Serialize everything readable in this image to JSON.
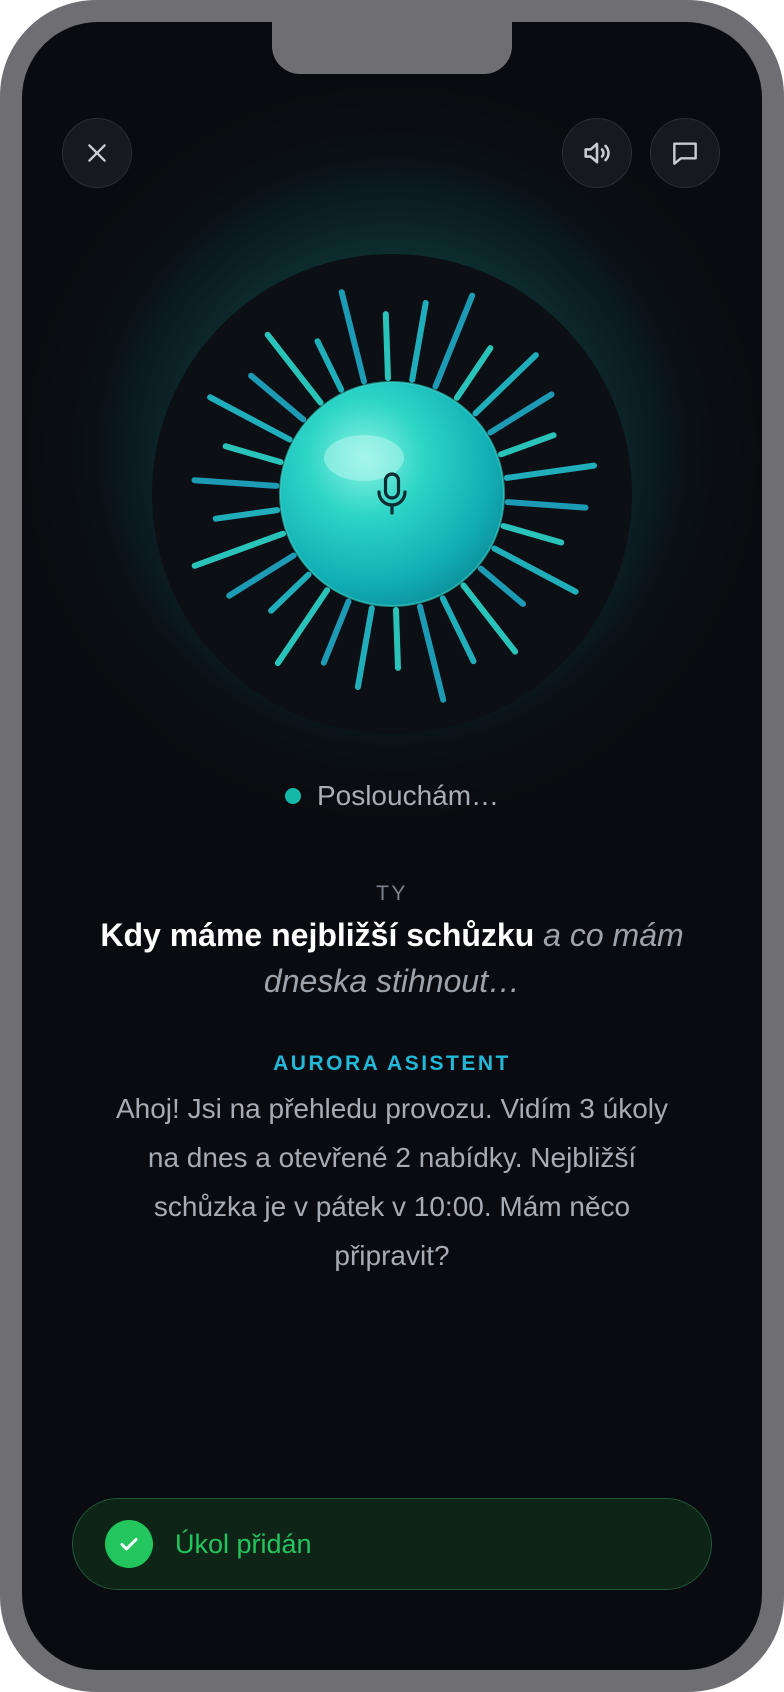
{
  "status": {
    "text": "Poslouchám…"
  },
  "conversation": {
    "user_label": "TY",
    "user_text_strong": "Kdy máme nejbližší schůzku",
    "user_text_interim": "a co mám dneska stihnout…",
    "assistant_label": "AURORA ASISTENT",
    "assistant_text": "Ahoj! Jsi na přehledu provozu. Vidím 3 úkoly na dnes a otevřené 2 nabídky. Nejbližší schůzka je v pátek v 10:00. Mám něco připravit?"
  },
  "toast": {
    "text": "Úkol přidán"
  },
  "icons": {
    "close": "close-icon",
    "volume": "speaker-icon",
    "chat": "chat-bubble-icon",
    "mic": "microphone-icon",
    "check": "check-icon"
  },
  "colors": {
    "accent": "#14b8a6",
    "assistant_label": "#22b8d8",
    "success": "#22c55e",
    "background": "#0a0b10"
  }
}
